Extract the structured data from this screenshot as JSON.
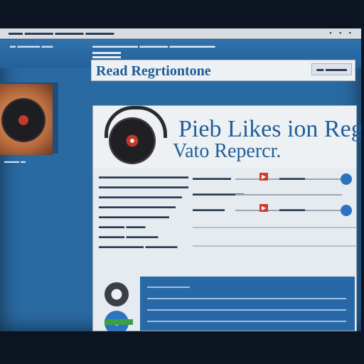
{
  "window": {
    "title": "▬▬ ▬▬▬▬ ▬▬▬▬ ▬▬▬▬",
    "controls": "▪ ▪ ▪"
  },
  "strip": {
    "links": "▬ ▬▬▬▬ ▬▬",
    "address": "▬▬▬▬▬▬▬▬ ▬▬▬▬▬ ▬▬▬▬▬▬▬▬"
  },
  "banner": {
    "title": "Read Regrtiontone",
    "button": "▬ ▬▬▬"
  },
  "hero": {
    "line1": "Pieb Likes ion Reg",
    "line2": "Vato Repercr."
  },
  "left_caption": "▬▬▬ ▬",
  "rows": [
    "▬▬▬▬▬▬▬▬▬▬▬▬▬▬",
    "▬▬▬▬▬▬▬▬▬▬▬▬▬▬",
    "▬▬▬▬▬▬▬▬▬▬▬▬▬",
    "▬▬▬▬▬▬▬▬▬▬▬▬",
    "▬▬▬▬▬▬▬▬▬▬▬",
    "▬▬▬▬ ▬▬▬",
    "▬▬▬▬ ▬▬▬▬▬",
    "▬▬▬▬▬▬▬ ▬▬▬▬▬"
  ],
  "right_rows": [
    {
      "label": "▬▬▬▬▬▬",
      "tag": "▶",
      "value": "▬▬▬▬"
    },
    {
      "label": "▬▬▬▬▬▬▬▬",
      "tag": "",
      "value": ""
    },
    {
      "label": "▬▬▬▬▬",
      "tag": "▶",
      "value": "▬▬▬▬"
    }
  ],
  "colors": {
    "accent": "#2a6aa3",
    "title_text": "#1f5f9a",
    "tag": "#d33a2a",
    "knob": "#2d72c0"
  },
  "icons": [
    "album-art-icon",
    "vinyl-record-icon",
    "headphones-icon",
    "settings-dial-icon",
    "globe-icon"
  ]
}
